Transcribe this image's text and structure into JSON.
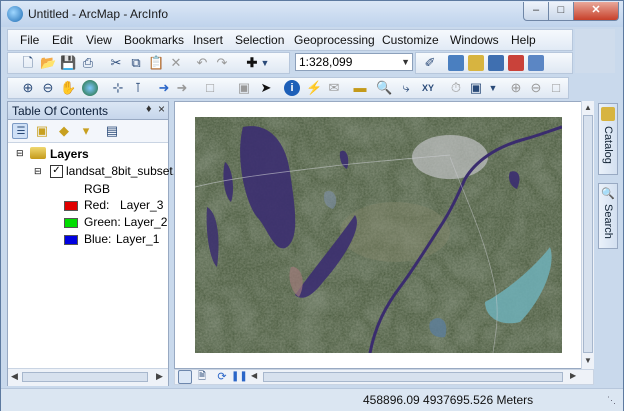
{
  "window": {
    "title": "Untitled - ArcMap - ArcInfo"
  },
  "menu": [
    "File",
    "Edit",
    "View",
    "Bookmarks",
    "Insert",
    "Selection",
    "Geoprocessing",
    "Customize",
    "Windows",
    "Help"
  ],
  "scale": {
    "value": "1:328,099"
  },
  "toc": {
    "title": "Table Of Contents",
    "layers_label": "Layers",
    "layer_name": "landsat_8bit_subset.",
    "rgb_label": "RGB",
    "bands": [
      {
        "label": "Red:",
        "value": "Layer_3",
        "color": "#e00000"
      },
      {
        "label": "Green:",
        "value": "Layer_2",
        "color": "#00dd00"
      },
      {
        "label": "Blue:",
        "value": "Layer_1",
        "color": "#0000e0"
      }
    ]
  },
  "dock": {
    "catalog": "Catalog",
    "search": "Search"
  },
  "status": {
    "coords": "458896.09  4937695.526 Meters"
  },
  "icons": [
    "new-icon",
    "open-icon",
    "save-icon",
    "print-icon",
    "cut-icon",
    "copy-icon",
    "paste-icon",
    "delete-icon",
    "undo-icon",
    "redo-icon",
    "add-data-icon",
    "zoom-in-icon",
    "zoom-out-icon",
    "pan-icon",
    "full-extent-icon",
    "select-icon",
    "identify-icon",
    "find-icon",
    "go-to-xy-icon",
    "catalog-icon",
    "search-icon"
  ]
}
